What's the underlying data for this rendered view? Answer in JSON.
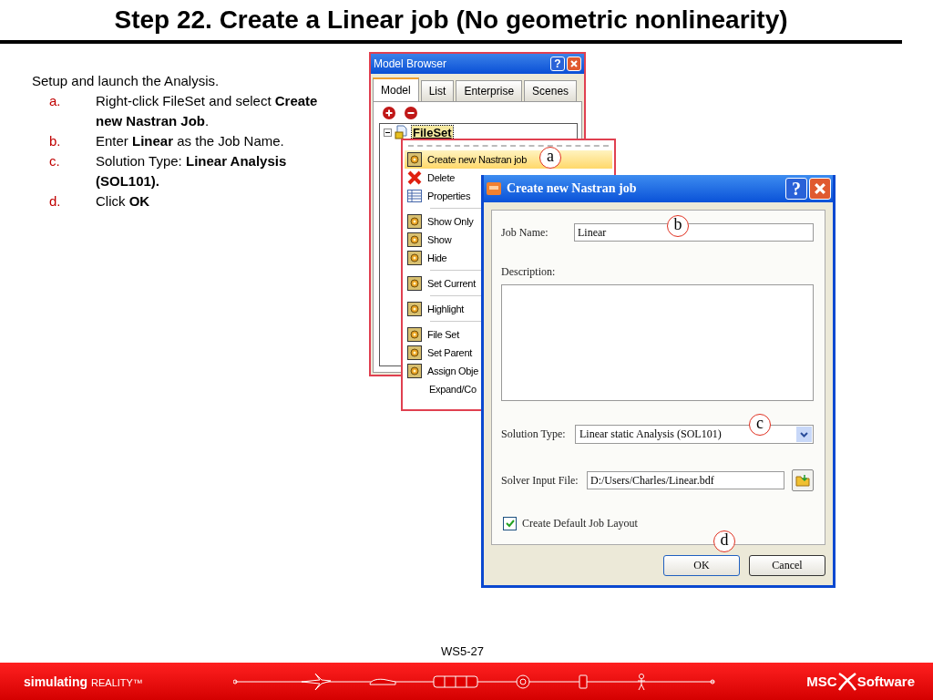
{
  "slide": {
    "title": "Step 22. Create a Linear job (No geometric nonlinearity)",
    "intro": "Setup and launch the Analysis.",
    "steps": [
      {
        "marker": "a.",
        "text": "Right-click FileSet and select **Create new Nastran Job**."
      },
      {
        "marker": "b.",
        "text": "Enter **Linear** as the Job Name."
      },
      {
        "marker": "c.",
        "text": "Solution Type: **Linear Analysis (SOL101).**"
      },
      {
        "marker": "d.",
        "text": "Click **OK**"
      }
    ],
    "page_number": "WS5-27"
  },
  "model_browser": {
    "title": "Model Browser",
    "help": "?",
    "tabs": [
      {
        "label": "Model",
        "selected": true
      },
      {
        "label": "List",
        "selected": false
      },
      {
        "label": "Enterprise",
        "selected": false
      },
      {
        "label": "Scenes",
        "selected": false
      }
    ],
    "tree": {
      "root": "FileSet",
      "selected": true
    }
  },
  "context_menu": {
    "items": [
      {
        "kind": "gear",
        "label": "Create new Nastran job",
        "selected": true
      },
      {
        "kind": "delete",
        "label": "Delete",
        "selected": false
      },
      {
        "kind": "properties",
        "label": "Properties",
        "selected": false
      },
      {
        "kind": "separator"
      },
      {
        "kind": "gear",
        "label": "Show Only",
        "selected": false
      },
      {
        "kind": "gear",
        "label": "Show",
        "selected": false
      },
      {
        "kind": "gear",
        "label": "Hide",
        "selected": false
      },
      {
        "kind": "separator"
      },
      {
        "kind": "gear",
        "label": "Set Current",
        "selected": false
      },
      {
        "kind": "separator"
      },
      {
        "kind": "gear",
        "label": "Highlight",
        "selected": false
      },
      {
        "kind": "separator"
      },
      {
        "kind": "gear",
        "label": "File Set",
        "selected": false
      },
      {
        "kind": "gear",
        "label": "Set Parent",
        "selected": false
      },
      {
        "kind": "gear",
        "label": "Assign Obje",
        "selected": false
      },
      {
        "kind": "plain",
        "label": "Expand/Co",
        "selected": false
      }
    ]
  },
  "dialog": {
    "title": "Create new Nastran job",
    "help": "?",
    "job_name_label": "Job Name:",
    "job_name": "Linear",
    "description_label": "Description:",
    "solution_type_label": "Solution Type:",
    "solution_type": "Linear static Analysis (SOL101)",
    "solver_input_label": "Solver Input File:",
    "solver_input": "D:/Users/Charles/Linear.bdf",
    "checkbox": {
      "label": "Create Default Job Layout",
      "checked": true
    },
    "buttons": [
      {
        "label": "OK",
        "kind": "default"
      },
      {
        "label": "Cancel",
        "kind": "normal"
      }
    ]
  },
  "callouts": [
    {
      "letter": "a"
    },
    {
      "letter": "b"
    },
    {
      "letter": "c"
    },
    {
      "letter": "d"
    }
  ],
  "footer": {
    "tagline_bold": "simulating",
    "tagline": "REALITY™",
    "logo_left": "MSC",
    "logo_right": "Software"
  }
}
